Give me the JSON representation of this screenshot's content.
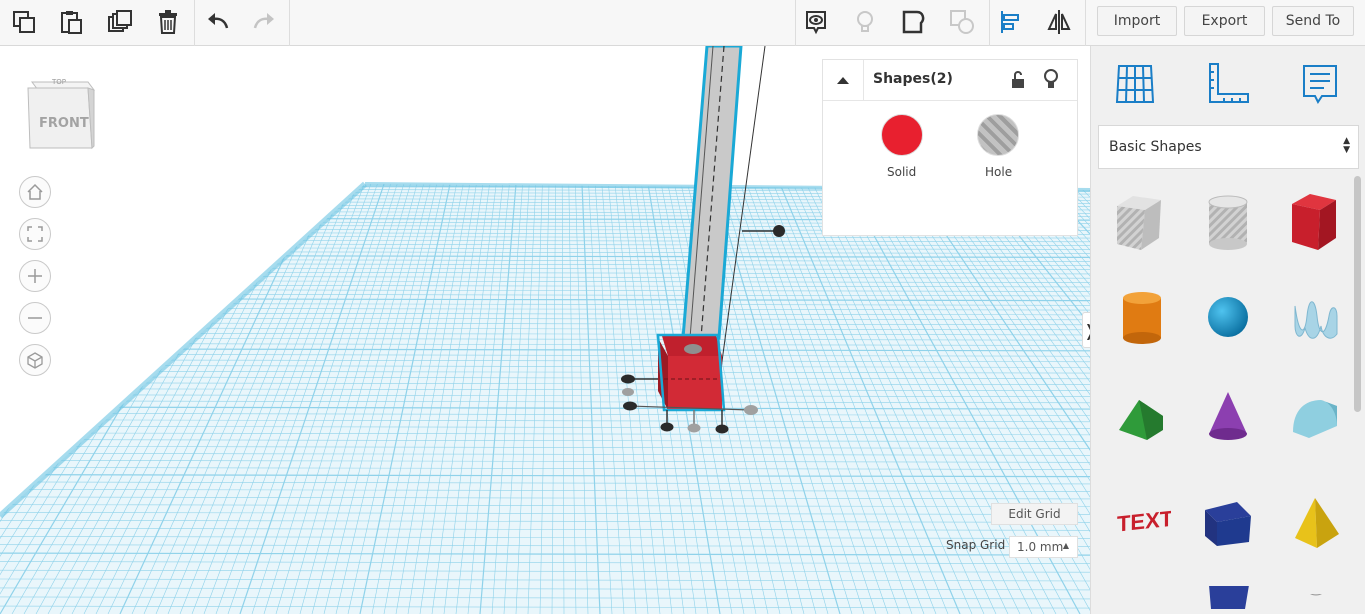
{
  "toolbar": {
    "tools": [
      {
        "name": "copy-icon"
      },
      {
        "name": "paste-icon"
      },
      {
        "name": "duplicate-icon"
      },
      {
        "name": "delete-icon"
      },
      {
        "name": "undo-icon"
      },
      {
        "name": "redo-icon"
      }
    ],
    "view_tools": [
      {
        "name": "show-all-icon"
      },
      {
        "name": "lightbulb-icon"
      },
      {
        "name": "group-icon"
      },
      {
        "name": "ungroup-icon"
      },
      {
        "name": "align-icon"
      },
      {
        "name": "mirror-icon"
      }
    ],
    "import_label": "Import",
    "export_label": "Export",
    "send_to_label": "Send To"
  },
  "viewcube": {
    "top_label": "TOP",
    "front_label": "FRONT"
  },
  "nav": [
    {
      "name": "home-view-icon"
    },
    {
      "name": "fit-view-icon"
    },
    {
      "name": "zoom-in-icon"
    },
    {
      "name": "zoom-out-icon"
    },
    {
      "name": "perspective-icon"
    }
  ],
  "inspector": {
    "title": "Shapes(2)",
    "solid_label": "Solid",
    "hole_label": "Hole",
    "solid_color": "#e8202f",
    "hole_color": "#b8b8b8"
  },
  "workplane": {
    "edit_grid_label": "Edit Grid",
    "snap_grid_label": "Snap Grid",
    "snap_value": "1.0 mm",
    "grid_color": "#7fd0ea"
  },
  "panel": {
    "tabs": [
      {
        "name": "workplane-tab-icon"
      },
      {
        "name": "ruler-tab-icon"
      },
      {
        "name": "notes-tab-icon"
      }
    ],
    "library_label": "Basic Shapes",
    "accent": "#1a7ec7",
    "shapes": [
      {
        "name": "box-hole-shape"
      },
      {
        "name": "cylinder-hole-shape"
      },
      {
        "name": "box-shape"
      },
      {
        "name": "cylinder-shape"
      },
      {
        "name": "sphere-shape"
      },
      {
        "name": "scribble-shape"
      },
      {
        "name": "roof-shape"
      },
      {
        "name": "cone-shape"
      },
      {
        "name": "round-roof-shape"
      },
      {
        "name": "text-shape"
      },
      {
        "name": "prism-shape"
      },
      {
        "name": "pyramid-shape"
      }
    ]
  }
}
